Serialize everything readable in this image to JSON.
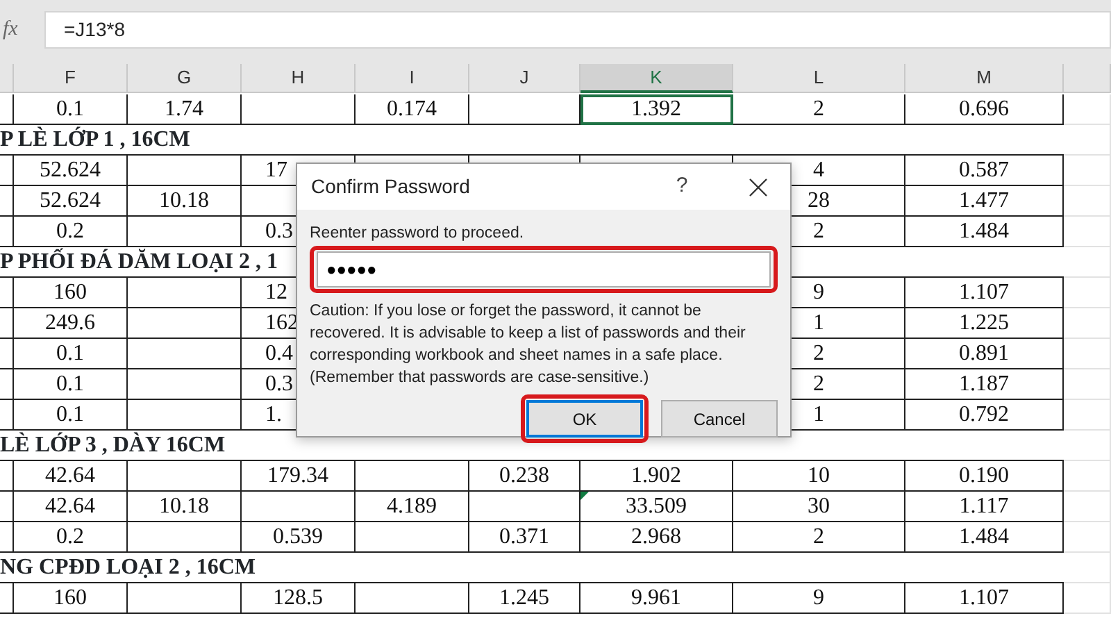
{
  "formula_bar": {
    "function_label": "fx",
    "formula": "=J13*8"
  },
  "columns": [
    {
      "label": "F",
      "selected": false
    },
    {
      "label": "G",
      "selected": false
    },
    {
      "label": "H",
      "selected": false
    },
    {
      "label": "I",
      "selected": false
    },
    {
      "label": "J",
      "selected": false
    },
    {
      "label": "K",
      "selected": true
    },
    {
      "label": "L",
      "selected": false
    },
    {
      "label": "M",
      "selected": false
    }
  ],
  "rows": [
    {
      "kind": "data",
      "cells": [
        "0.1",
        "1.74",
        null,
        "0.174",
        null,
        {
          "text": "1.392",
          "active": true
        },
        "2",
        "0.696"
      ]
    },
    {
      "kind": "section",
      "text": "P LÈ LỚP 1 , 16CM"
    },
    {
      "kind": "data",
      "cells": [
        "52.624",
        null,
        "17",
        null,
        null,
        null,
        "4",
        "0.587"
      ]
    },
    {
      "kind": "data",
      "cells": [
        "52.624",
        "10.18",
        null,
        null,
        null,
        null,
        "28",
        "1.477"
      ]
    },
    {
      "kind": "data",
      "cells": [
        "0.2",
        null,
        "0.3",
        null,
        null,
        null,
        "2",
        "1.484"
      ]
    },
    {
      "kind": "section",
      "text": "P PHỐI ĐÁ DĂM LOẠI 2 , 1"
    },
    {
      "kind": "data",
      "cells": [
        "160",
        null,
        "12",
        null,
        null,
        null,
        "9",
        "1.107"
      ]
    },
    {
      "kind": "data",
      "cells": [
        "249.6",
        null,
        "162",
        null,
        null,
        null,
        "1",
        "1.225"
      ]
    },
    {
      "kind": "data",
      "cells": [
        "0.1",
        null,
        "0.4",
        null,
        null,
        null,
        "2",
        "0.891"
      ]
    },
    {
      "kind": "data",
      "cells": [
        "0.1",
        null,
        "0.3",
        null,
        null,
        null,
        "2",
        "1.187"
      ]
    },
    {
      "kind": "data",
      "cells": [
        "0.1",
        null,
        "1.",
        null,
        null,
        null,
        "1",
        "0.792"
      ]
    },
    {
      "kind": "section",
      "text": "LÈ LỚP 3 , DÀY 16CM"
    },
    {
      "kind": "data",
      "cells": [
        "42.64",
        null,
        "179.34",
        null,
        "0.238",
        "1.902",
        "10",
        "0.190"
      ]
    },
    {
      "kind": "data",
      "cells": [
        "42.64",
        "10.18",
        null,
        "4.189",
        null,
        {
          "text": "33.509",
          "flagged": true
        },
        "30",
        "1.117"
      ]
    },
    {
      "kind": "data",
      "cells": [
        "0.2",
        null,
        "0.539",
        null,
        "0.371",
        "2.968",
        "2",
        "1.484"
      ]
    },
    {
      "kind": "section",
      "text": "NG CPĐD LOẠI 2 , 16CM"
    },
    {
      "kind": "data",
      "cells": [
        "160",
        null,
        "128.5",
        null,
        "1.245",
        "9.961",
        "9",
        "1.107"
      ]
    }
  ],
  "dialog": {
    "title": "Confirm Password",
    "help": "?",
    "prompt": "Reenter password to proceed.",
    "password": "●●●●●",
    "password_highlighted": true,
    "caution": "Caution: If you lose or forget the password, it cannot be recovered. It is advisable to keep a list of passwords and their corresponding workbook and sheet names in a safe place. (Remember that passwords are case-sensitive.)",
    "buttons": [
      {
        "label": "OK",
        "focused": true,
        "highlighted": true
      },
      {
        "label": "Cancel",
        "focused": false,
        "highlighted": false
      }
    ]
  }
}
